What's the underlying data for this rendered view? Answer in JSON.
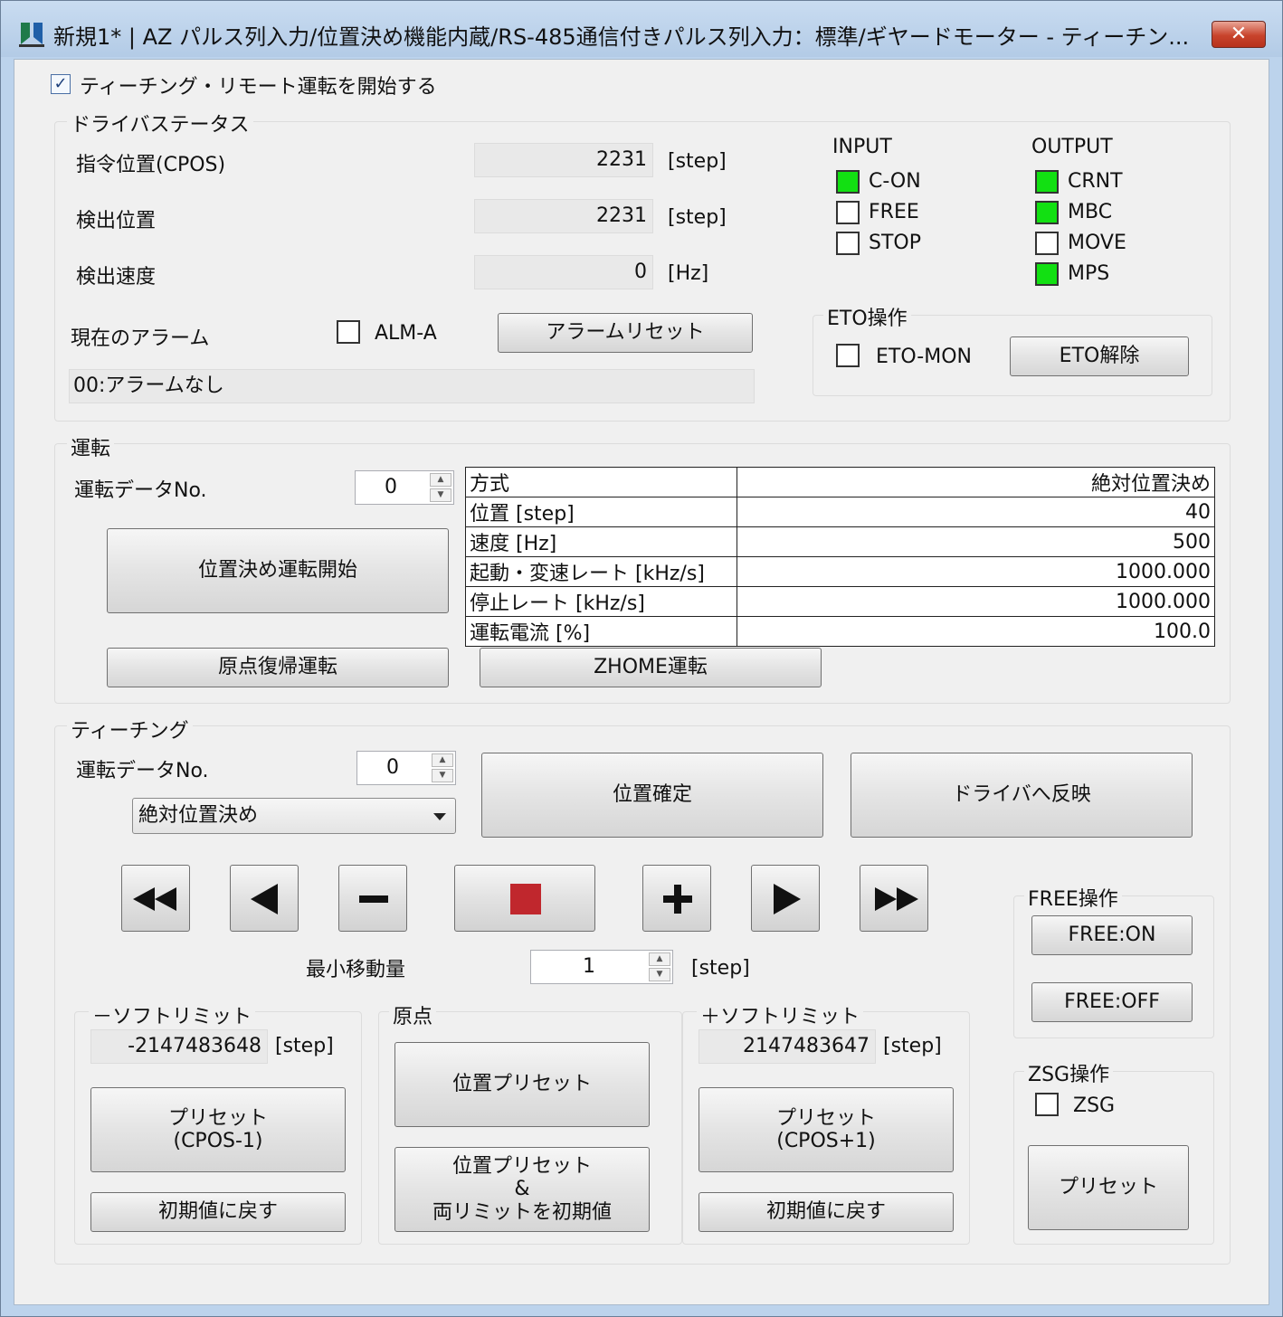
{
  "window": {
    "title": "新規1* | AZ パルス列入力/位置決め機能内蔵/RS-485通信付きパルス列入力：標準/ギヤードモーター - ティーチン...",
    "close_label": "✕"
  },
  "teaching_remote": {
    "label": "ティーチング・リモート運転を開始する",
    "checked": true
  },
  "driver_status": {
    "title": "ドライバステータス",
    "cpos_label": "指令位置(CPOS)",
    "cpos_value": "2231",
    "cpos_unit": "[step]",
    "detect_pos_label": "検出位置",
    "detect_pos_value": "2231",
    "detect_pos_unit": "[step]",
    "detect_speed_label": "検出速度",
    "detect_speed_value": "0",
    "detect_speed_unit": "[Hz]",
    "alarm_label": "現在のアラーム",
    "alarm_chk_label": "ALM-A",
    "alarm_reset_label": "アラームリセット",
    "alarm_text": "00:アラームなし",
    "input_title": "INPUT",
    "inputs": [
      {
        "label": "C-ON",
        "on": true
      },
      {
        "label": "FREE",
        "on": false
      },
      {
        "label": "STOP",
        "on": false
      }
    ],
    "output_title": "OUTPUT",
    "outputs": [
      {
        "label": "CRNT",
        "on": true
      },
      {
        "label": "MBC",
        "on": true
      },
      {
        "label": "MOVE",
        "on": false
      },
      {
        "label": "MPS",
        "on": true
      }
    ],
    "eto_title": "ETO操作",
    "eto_mon_label": "ETO-MON",
    "eto_release_label": "ETO解除"
  },
  "operation": {
    "title": "運転",
    "data_no_label": "運転データNo.",
    "data_no_value": "0",
    "start_label": "位置決め運転開始",
    "home_label": "原点復帰運転",
    "zhome_label": "ZHOME運転",
    "params": [
      {
        "name": "方式",
        "value": "絶対位置決め"
      },
      {
        "name": "位置 [step]",
        "value": "40"
      },
      {
        "name": "速度 [Hz]",
        "value": "500"
      },
      {
        "name": "起動・変速レート [kHz/s]",
        "value": "1000.000"
      },
      {
        "name": "停止レート [kHz/s]",
        "value": "1000.000"
      },
      {
        "name": "運転電流 [%]",
        "value": "100.0"
      }
    ]
  },
  "teaching": {
    "title": "ティーチング",
    "data_no_label": "運転データNo.",
    "data_no_value": "0",
    "mode_value": "絶対位置決め",
    "confirm_label": "位置確定",
    "reflect_label": "ドライバへ反映",
    "min_move_label": "最小移動量",
    "min_move_value": "1",
    "min_move_unit": "[step]",
    "minus_limit": {
      "title": "－ソフトリミット",
      "value": "-2147483648",
      "unit": "[step]",
      "preset_line1": "プリセット",
      "preset_line2": "(CPOS-1)",
      "reset_label": "初期値に戻す"
    },
    "origin": {
      "title": "原点",
      "preset_label": "位置プリセット",
      "preset_all_line1": "位置プリセット",
      "preset_all_line2": "&",
      "preset_all_line3": "両リミットを初期値"
    },
    "plus_limit": {
      "title": "＋ソフトリミット",
      "value": "2147483647",
      "unit": "[step]",
      "preset_line1": "プリセット",
      "preset_line2": "(CPOS+1)",
      "reset_label": "初期値に戻す"
    },
    "free_op": {
      "title": "FREE操作",
      "on_label": "FREE:ON",
      "off_label": "FREE:OFF"
    },
    "zsg_op": {
      "title": "ZSG操作",
      "chk_label": "ZSG",
      "preset_label": "プリセット"
    }
  },
  "colors": {
    "led_on": "#12e012",
    "stop_red": "#c0272d"
  }
}
